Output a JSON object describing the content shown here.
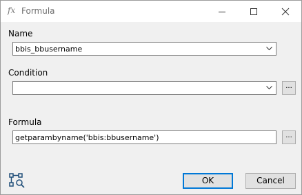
{
  "window": {
    "title": "Formula",
    "title_icon": "fx"
  },
  "name": {
    "label": "Name",
    "value": "bbis_bbusername"
  },
  "condition": {
    "label": "Condition",
    "value": "",
    "browse_label": "..."
  },
  "formula": {
    "label": "Formula",
    "value": "getparambyname('bbis:bbusername')",
    "browse_label": "..."
  },
  "buttons": {
    "ok": "OK",
    "cancel": "Cancel"
  },
  "icons": {
    "title": "fx-icon",
    "bottom": "diagram-search-icon",
    "accent": "#0078d7",
    "bottom_icon_color": "#1f4e79"
  }
}
